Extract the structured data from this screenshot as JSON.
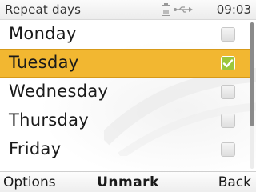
{
  "header": {
    "title": "Repeat days",
    "time": "09:03",
    "icons": [
      "battery-icon",
      "usb-icon"
    ]
  },
  "days": [
    {
      "label": "Monday",
      "checked": false,
      "selected": false
    },
    {
      "label": "Tuesday",
      "checked": true,
      "selected": true
    },
    {
      "label": "Wednesday",
      "checked": false,
      "selected": false
    },
    {
      "label": "Thursday",
      "checked": false,
      "selected": false
    },
    {
      "label": "Friday",
      "checked": false,
      "selected": false
    }
  ],
  "scroll": {
    "visible_fraction": 0.71,
    "position_fraction": 0
  },
  "softkeys": {
    "left": "Options",
    "middle": "Unmark",
    "right": "Back"
  },
  "colors": {
    "highlight": "#f2b731",
    "check": "#9dc63b"
  }
}
